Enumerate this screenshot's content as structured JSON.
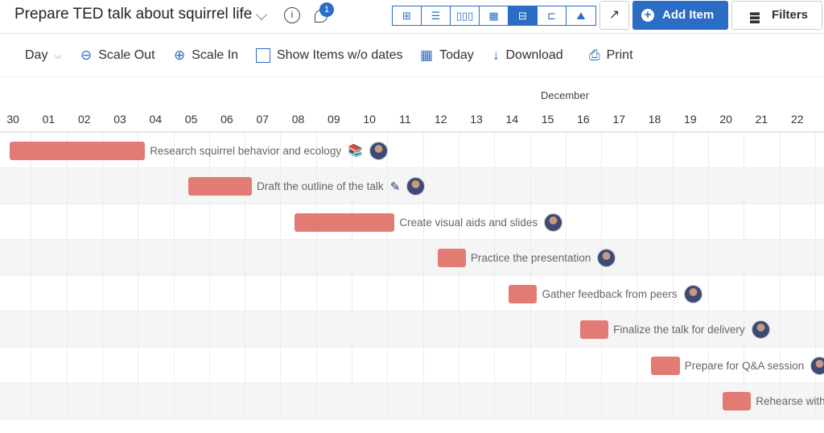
{
  "header": {
    "title": "Prepare TED talk about squirrel life",
    "info_icon": "i",
    "notification_count": "1",
    "views": [
      {
        "name": "grid-view",
        "glyph": "⊞"
      },
      {
        "name": "checklist-view",
        "glyph": "☰"
      },
      {
        "name": "board-view",
        "glyph": "▯▯▯"
      },
      {
        "name": "calendar-view",
        "glyph": "▦"
      },
      {
        "name": "timeline-view",
        "glyph": "⊟",
        "active": true
      },
      {
        "name": "pages-view",
        "glyph": "⊏"
      },
      {
        "name": "charts-view",
        "glyph": "⛰"
      }
    ],
    "share_icon": "↗",
    "add_item": "Add Item",
    "add_icon": "+",
    "filters": "Filters"
  },
  "toolbar": {
    "scale": "Day",
    "scale_out": "Scale Out",
    "scale_in": "Scale In",
    "show_items": "Show Items w/o dates",
    "today": "Today",
    "download": "Download",
    "print": "Print"
  },
  "timeline": {
    "month": "December",
    "days": [
      "30",
      "01",
      "02",
      "03",
      "04",
      "05",
      "06",
      "07",
      "08",
      "09",
      "10",
      "11",
      "12",
      "13",
      "14",
      "15",
      "16",
      "17",
      "18",
      "19",
      "20",
      "21",
      "22"
    ],
    "tasks": [
      {
        "name": "Research squirrel behavior and ecology",
        "start": 0,
        "duration": 4,
        "icon": "book-icon"
      },
      {
        "name": "Draft the outline of the talk",
        "start": 5,
        "duration": 2,
        "icon": "pencil-icon"
      },
      {
        "name": "Create visual aids and slides",
        "start": 8,
        "duration": 3
      },
      {
        "name": "Practice the presentation",
        "start": 12,
        "duration": 1
      },
      {
        "name": "Gather feedback from peers",
        "start": 14,
        "duration": 1
      },
      {
        "name": "Finalize the talk for delivery",
        "start": 16,
        "duration": 1
      },
      {
        "name": "Prepare for Q&A session",
        "start": 18,
        "duration": 1
      },
      {
        "name": "Rehearse with",
        "start": 20,
        "duration": 1
      }
    ],
    "bar_color": "#e37b75"
  }
}
